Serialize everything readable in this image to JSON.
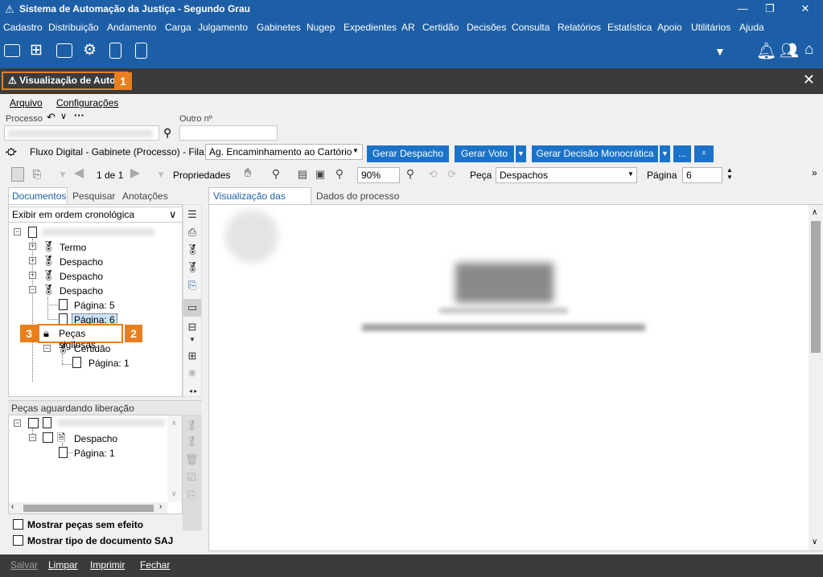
{
  "app": {
    "title": "Sistema de Automação da Justiça - Segundo Grau"
  },
  "menu": [
    "Cadastro",
    "Distribuição",
    "Andamento",
    "Carga",
    "Julgamento",
    "Gabinetes",
    "Nugep",
    "Expedientes",
    "AR",
    "Certidão",
    "Decisões",
    "Consulta",
    "Relatórios",
    "Estatística",
    "Apoio",
    "Utilitários",
    "Ajuda"
  ],
  "tab": {
    "label": "Visualização de Autos"
  },
  "callouts": {
    "one": "1",
    "two": "2",
    "three": "3"
  },
  "submenu": {
    "arquivo": "Arquivo",
    "config": "Configurações"
  },
  "processo": {
    "label": "Processo",
    "outro_label": "Outro nº"
  },
  "fluxo": {
    "label": "Fluxo Digital - Gabinete (Processo) - Fila:",
    "fila_value": "Ag. Encaminhamento ao Cartório",
    "btn_despacho": "Gerar Despacho",
    "btn_voto": "Gerar Voto",
    "btn_decisao": "Gerar Decisão Monocrática",
    "btn_more": "..."
  },
  "toolbar": {
    "page_of": "1 de 1",
    "propriedades": "Propriedades",
    "zoom": "90%",
    "peca_label": "Peça",
    "peca_value": "Despachos",
    "pagina_label": "Página",
    "pagina_value": "6"
  },
  "left_tabs": {
    "documentos": "Documentos",
    "pesquisar": "Pesquisar",
    "anotacoes": "Anotações"
  },
  "order_select": "Exibir em ordem cronológica",
  "tree": {
    "termo": "Termo",
    "despacho1": "Despacho",
    "despacho2": "Despacho",
    "despacho3": "Despacho",
    "pagina5": "Página: 5",
    "pagina6": "Página: 6",
    "sigilosas": "Peças sigilosas",
    "certidao": "Certidão",
    "pagina1": "Página: 1"
  },
  "aguardando": {
    "title": "Peças aguardando liberação",
    "despacho": "Despacho",
    "pagina1": "Página: 1"
  },
  "checks": {
    "sem_efeito": "Mostrar peças sem efeito",
    "tipo_doc": "Mostrar tipo de documento SAJ"
  },
  "viewer_tabs": {
    "pecas": "Visualização das peças",
    "dados": "Dados do processo"
  },
  "bottom": {
    "salvar": "Salvar",
    "limpar": "Limpar",
    "imprimir": "Imprimir",
    "fechar": "Fechar"
  },
  "colors": {
    "brand": "#1d5fa6",
    "accent": "#e87f1e",
    "button": "#1b73c9"
  }
}
